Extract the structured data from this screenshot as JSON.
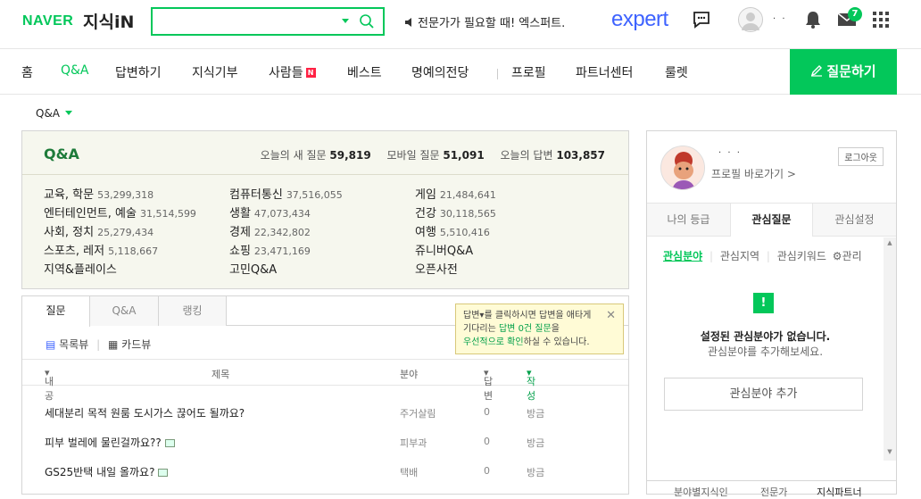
{
  "header": {
    "logo_naver": "NAVER",
    "logo_kin": "지식iN",
    "search_placeholder": "",
    "notice": "전문가가 필요할 때! 엑스퍼트.",
    "expert_logo": "expert",
    "user_name": "· ·",
    "mail_badge": "7"
  },
  "nav": {
    "items": [
      "홈",
      "Q&A",
      "답변하기",
      "지식기부",
      "사람들",
      "베스트",
      "명예의전당",
      "프로필",
      "파트너센터",
      "룰렛"
    ],
    "people_badge": "N",
    "ask_button": "질문하기"
  },
  "filter": {
    "selected": "Q&A"
  },
  "qa": {
    "title": "Q&A",
    "stat_labels": [
      "오늘의 새 질문",
      "모바일 질문",
      "오늘의 답변"
    ],
    "stat_values": [
      "59,819",
      "51,091",
      "103,857"
    ],
    "categories": [
      {
        "name": "교육, 학문",
        "count": "53,299,318"
      },
      {
        "name": "엔터테인먼트, 예술",
        "count": "31,514,599"
      },
      {
        "name": "사회, 정치",
        "count": "25,279,434"
      },
      {
        "name": "스포츠, 레저",
        "count": "5,118,667"
      },
      {
        "name": "지역&플레이스",
        "count": ""
      },
      {
        "name": "컴퓨터통신",
        "count": "37,516,055"
      },
      {
        "name": "생활",
        "count": "47,073,434"
      },
      {
        "name": "경제",
        "count": "22,342,802"
      },
      {
        "name": "쇼핑",
        "count": "23,471,169"
      },
      {
        "name": "고민Q&A",
        "count": ""
      },
      {
        "name": "게임",
        "count": "21,484,641"
      },
      {
        "name": "건강",
        "count": "30,118,565"
      },
      {
        "name": "여행",
        "count": "5,510,416"
      },
      {
        "name": "쥬니버Q&A",
        "count": ""
      },
      {
        "name": "오픈사전",
        "count": ""
      }
    ]
  },
  "list": {
    "tabs": [
      "질문",
      "Q&A",
      "랭킹"
    ],
    "views": [
      "목록뷰",
      "카드뷰"
    ],
    "columns": [
      "내공",
      "제목",
      "분야",
      "답변",
      "작성"
    ],
    "rows": [
      {
        "title": "세대분리 목적 원룸 도시가스 끊어도 될까요?",
        "field": "주거살림",
        "answers": "0",
        "time": "방금",
        "img": false
      },
      {
        "title": "피부 벌레에 물린걸까요??",
        "field": "피부과",
        "answers": "0",
        "time": "방금",
        "img": true
      },
      {
        "title": "GS25반택 내일 올까요?",
        "field": "택배",
        "answers": "0",
        "time": "방금",
        "img": true
      }
    ],
    "tooltip": {
      "l1a": "답변",
      "l1b": "를 클릭하시면 답변을 애타게",
      "l2a": "기다리는 ",
      "l2b": "답변 0건 질문",
      "l2c": "을",
      "l3a": "우선적으로 확인",
      "l3b": "하실 수 있습니다."
    }
  },
  "sidebar": {
    "user_name": "· · ·",
    "logout": "로그아웃",
    "profile_link": "프로필 바로가기 >",
    "tabs": [
      "나의 등급",
      "관심질문",
      "관심설정"
    ],
    "subtabs": [
      "관심분야",
      "관심지역",
      "관심키워드",
      "관리"
    ],
    "empty_title": "설정된 관심분야가 없습니다.",
    "empty_desc": "관심분야를 추가해보세요.",
    "add_button": "관심분야 추가",
    "bottom_tabs": [
      "분야별지식인",
      "전문가",
      "지식파트너"
    ]
  }
}
